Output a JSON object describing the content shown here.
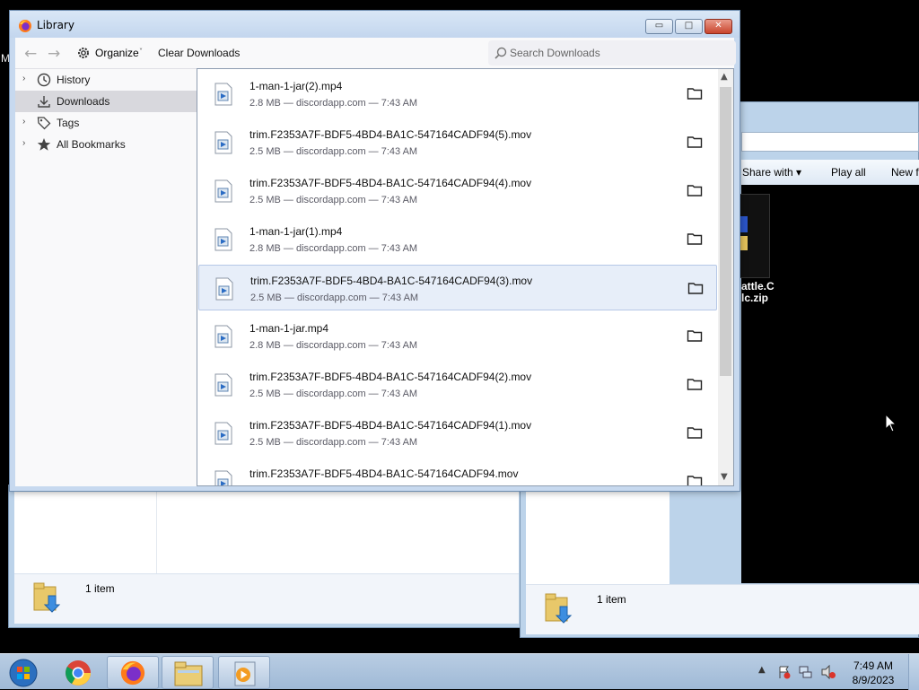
{
  "background": {
    "left_explorer_status": "1 item",
    "right_explorer_status": "1 item",
    "right_explorer_toolbar": {
      "share_with": "Share with ▾",
      "play_all": "Play all",
      "new_folder": "New f"
    },
    "desktop_file_label_1": "attle.C",
    "desktop_file_label_2": "lc.zip",
    "left_edge_text": "M"
  },
  "window": {
    "title": "Library",
    "buttons": {
      "minimize": "▭",
      "maximize": "□",
      "close": "✕"
    }
  },
  "toolbar": {
    "organize_label": "Organize",
    "clear_downloads_label": "Clear Downloads",
    "search_placeholder": "Search Downloads"
  },
  "sidebar": {
    "items": [
      {
        "label": "History",
        "icon": "clock-icon",
        "expandable": true,
        "selected": false
      },
      {
        "label": "Downloads",
        "icon": "download-icon",
        "expandable": false,
        "selected": true
      },
      {
        "label": "Tags",
        "icon": "tag-icon",
        "expandable": true,
        "selected": false
      },
      {
        "label": "All Bookmarks",
        "icon": "star-icon",
        "expandable": true,
        "selected": false
      }
    ]
  },
  "downloads": [
    {
      "name": "1-man-1-jar(2).mp4",
      "meta": "2.8 MB — discordapp.com — 7:43 AM",
      "selected": false
    },
    {
      "name": "trim.F2353A7F-BDF5-4BD4-BA1C-547164CADF94(5).mov",
      "meta": "2.5 MB — discordapp.com — 7:43 AM",
      "selected": false
    },
    {
      "name": "trim.F2353A7F-BDF5-4BD4-BA1C-547164CADF94(4).mov",
      "meta": "2.5 MB — discordapp.com — 7:43 AM",
      "selected": false
    },
    {
      "name": "1-man-1-jar(1).mp4",
      "meta": "2.8 MB — discordapp.com — 7:43 AM",
      "selected": false
    },
    {
      "name": "trim.F2353A7F-BDF5-4BD4-BA1C-547164CADF94(3).mov",
      "meta": "2.5 MB — discordapp.com — 7:43 AM",
      "selected": true
    },
    {
      "name": "1-man-1-jar.mp4",
      "meta": "2.8 MB — discordapp.com — 7:43 AM",
      "selected": false
    },
    {
      "name": "trim.F2353A7F-BDF5-4BD4-BA1C-547164CADF94(2).mov",
      "meta": "2.5 MB — discordapp.com — 7:43 AM",
      "selected": false
    },
    {
      "name": "trim.F2353A7F-BDF5-4BD4-BA1C-547164CADF94(1).mov",
      "meta": "2.5 MB — discordapp.com — 7:43 AM",
      "selected": false
    },
    {
      "name": "trim.F2353A7F-BDF5-4BD4-BA1C-547164CADF94.mov",
      "meta": "",
      "selected": false
    }
  ],
  "taskbar": {
    "time": "7:49 AM",
    "date": "8/9/2023",
    "apps": [
      "start-orb-icon",
      "chrome-icon",
      "firefox-icon",
      "file-explorer-icon",
      "media-player-icon"
    ]
  },
  "colors": {
    "selected_row": "#e7eef9",
    "sidebar_selected": "#d8d8dd",
    "taskbar": "#a9c1dc"
  }
}
